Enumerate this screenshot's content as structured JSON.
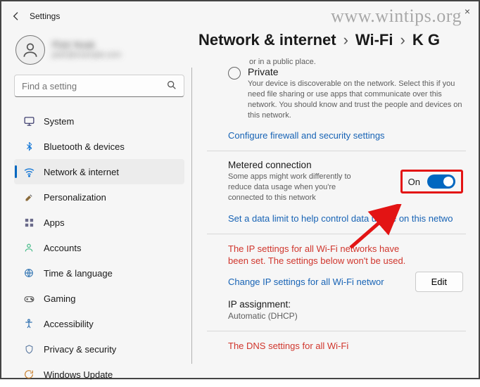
{
  "app": {
    "title": "Settings"
  },
  "watermark": "www.wintips.org",
  "profile": {
    "name": "Piotr Noak",
    "email": "piotr@example.com"
  },
  "search": {
    "placeholder": "Find a setting"
  },
  "close_label": "×",
  "sidebar": {
    "items": [
      {
        "label": "System"
      },
      {
        "label": "Bluetooth & devices"
      },
      {
        "label": "Network & internet",
        "selected": true
      },
      {
        "label": "Personalization"
      },
      {
        "label": "Apps"
      },
      {
        "label": "Accounts"
      },
      {
        "label": "Time & language"
      },
      {
        "label": "Gaming"
      },
      {
        "label": "Accessibility"
      },
      {
        "label": "Privacy & security"
      },
      {
        "label": "Windows Update"
      }
    ]
  },
  "breadcrumb": {
    "a": "Network & internet",
    "b": "Wi-Fi",
    "c": "K G",
    "sep": "›"
  },
  "panel": {
    "top_hair": "or in a public place.",
    "private": {
      "title": "Private",
      "desc": "Your device is discoverable on the network. Select this if you need file sharing or use apps that communicate over this network. You should know and trust the people and devices on this network."
    },
    "firewall_link": "Configure firewall and security settings",
    "metered": {
      "title": "Metered connection",
      "desc": "Some apps might work differently to reduce data usage when you're connected to this network",
      "toggle_label": "On"
    },
    "data_limit_link": "Set a data limit to help control data usage on this netwo",
    "ip": {
      "warn": "The IP settings for all Wi-Fi networks have been set. The settings below won't be used.",
      "change_link": "Change IP settings for all Wi-Fi networ",
      "edit_label": "Edit",
      "assign_label": "IP assignment:",
      "assign_value": "Automatic (DHCP)"
    },
    "dns_warn": "The DNS settings for all Wi-Fi"
  }
}
